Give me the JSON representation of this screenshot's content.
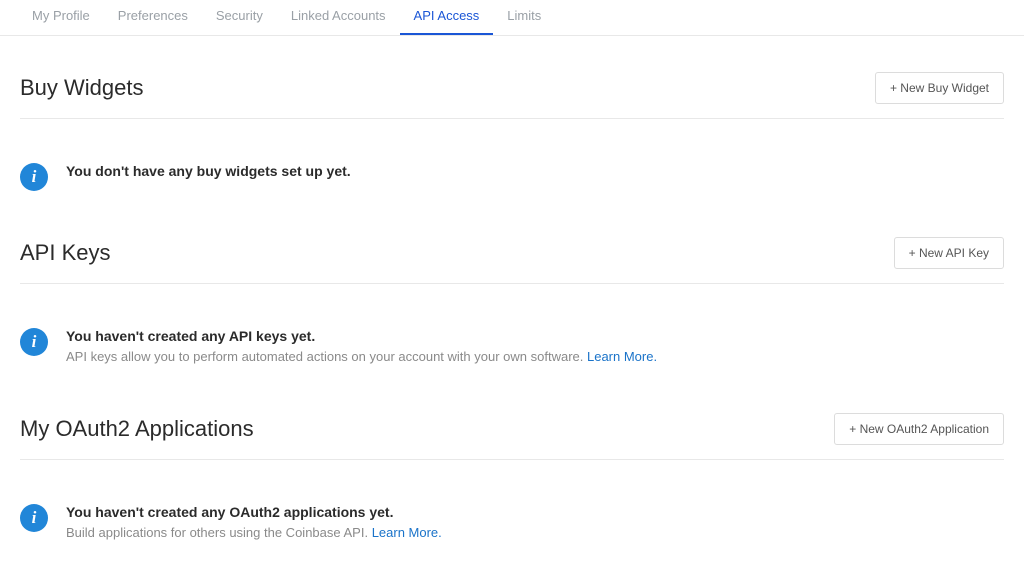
{
  "tabs": [
    {
      "label": "My Profile",
      "active": false
    },
    {
      "label": "Preferences",
      "active": false
    },
    {
      "label": "Security",
      "active": false
    },
    {
      "label": "Linked Accounts",
      "active": false
    },
    {
      "label": "API Access",
      "active": true
    },
    {
      "label": "Limits",
      "active": false
    }
  ],
  "sections": {
    "buy_widgets": {
      "title": "Buy Widgets",
      "button": "+ New Buy Widget",
      "info_title": "You don't have any buy widgets set up yet.",
      "info_sub": ""
    },
    "api_keys": {
      "title": "API Keys",
      "button": "+ New API Key",
      "info_title": "You haven't created any API keys yet.",
      "info_sub": "API keys allow you to perform automated actions on your account with your own software. ",
      "learn_more": "Learn More."
    },
    "oauth": {
      "title": "My OAuth2 Applications",
      "button": "+ New OAuth2 Application",
      "info_title": "You haven't created any OAuth2 applications yet.",
      "info_sub": "Build applications for others using the Coinbase API. ",
      "learn_more": "Learn More."
    }
  }
}
